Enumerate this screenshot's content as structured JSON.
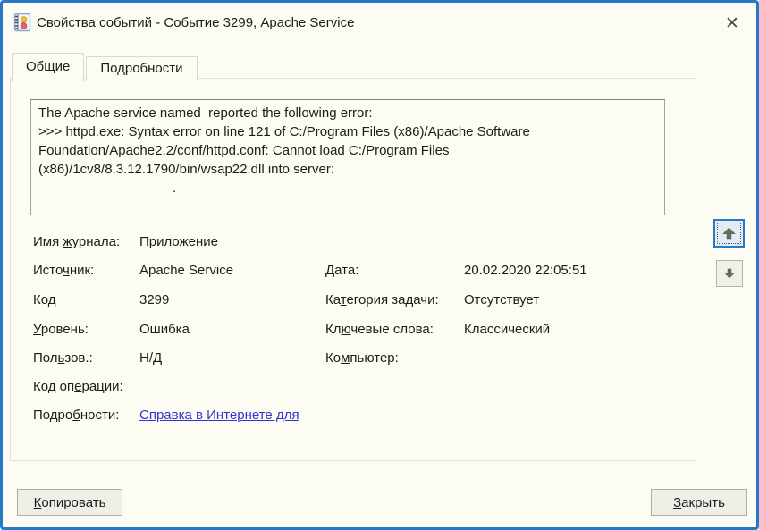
{
  "window": {
    "title": "Свойства событий - Событие 3299, Apache Service",
    "close_glyph": "✕"
  },
  "tabs": {
    "general": "Общие",
    "details": "Подробности"
  },
  "message": {
    "lines": [
      "The Apache service named  reported the following error:",
      ">>> httpd.exe: Syntax error on line 121 of C:/Program Files (x86)/Apache Software",
      "Foundation/Apache2.2/conf/httpd.conf: Cannot load C:/Program Files",
      "(x86)/1cv8/8.3.12.1790/bin/wsap22.dll into server:",
      "                                    ."
    ]
  },
  "fields": {
    "log_name": {
      "label": "Имя &журнала:",
      "value": "Приложение"
    },
    "source": {
      "label": "Исто&чник:",
      "value": "Apache Service"
    },
    "event_id": {
      "label": "Код",
      "value": "3299"
    },
    "level": {
      "label": "&Уровень:",
      "value": "Ошибка"
    },
    "user": {
      "label": "Пол&ьзов.:",
      "value": "Н/Д"
    },
    "opcode": {
      "label": "Код оп&ерации:",
      "value": ""
    },
    "more_info": {
      "label": "Подро&бности:",
      "link_text": "Справка в Интернете для "
    },
    "date": {
      "label": "&Дата:",
      "value": "20.02.2020 22:05:51"
    },
    "task_category": {
      "label": "Ка&тегория задачи:",
      "value": "Отсутствует"
    },
    "keywords": {
      "label": "Кл&ючевые слова:",
      "value": "Классический"
    },
    "computer": {
      "label": "Ко&мпьютер:",
      "value": ""
    }
  },
  "buttons": {
    "copy": "&Копировать",
    "close": "&Закрыть"
  },
  "colors": {
    "accent_border": "#2579c8",
    "link": "#3434d6",
    "background": "#fdfcf3"
  }
}
